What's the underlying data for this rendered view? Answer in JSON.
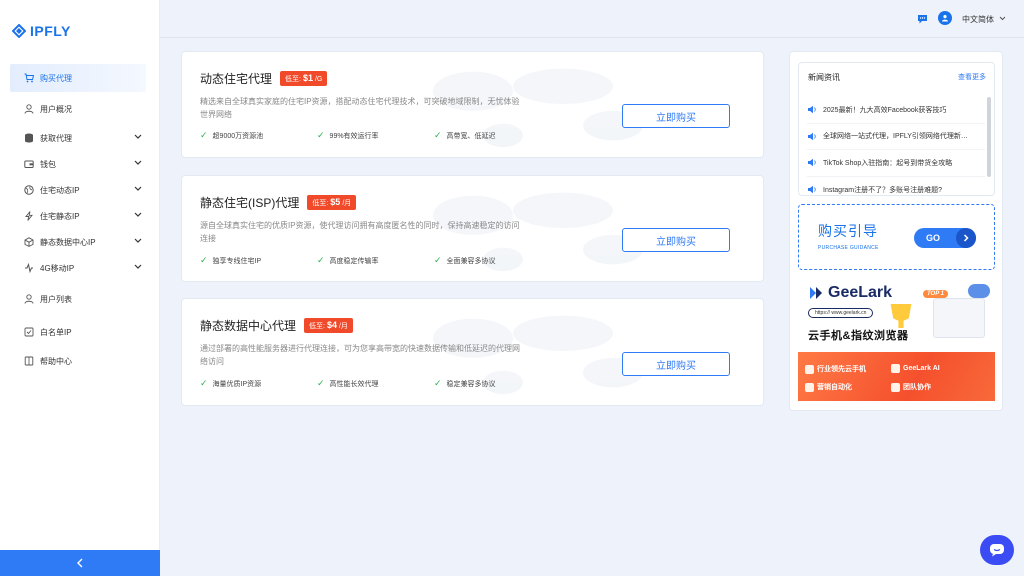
{
  "brand": {
    "name": "IPFLY"
  },
  "sidebar": {
    "items": [
      {
        "label": "购买代理",
        "icon": "cart-icon",
        "expandable": false,
        "active": true
      },
      {
        "label": "用户概况",
        "icon": "user-icon",
        "expandable": false
      },
      {
        "label": "获取代理",
        "icon": "database-icon",
        "expandable": true
      },
      {
        "label": "钱包",
        "icon": "wallet-icon",
        "expandable": true
      },
      {
        "label": "住宅动态IP",
        "icon": "globe-icon",
        "expandable": true
      },
      {
        "label": "住宅静态IP",
        "icon": "bolt-icon",
        "expandable": true
      },
      {
        "label": "静态数据中心IP",
        "icon": "cube-icon",
        "expandable": true
      },
      {
        "label": "4G移动IP",
        "icon": "signal-icon",
        "expandable": true
      },
      {
        "label": "用户列表",
        "icon": "user-list-icon",
        "expandable": false
      },
      {
        "label": "白名单IP",
        "icon": "checklist-icon",
        "expandable": false
      },
      {
        "label": "帮助中心",
        "icon": "book-icon",
        "expandable": false
      }
    ],
    "collapse_icon": "chevron-left-icon"
  },
  "header": {
    "language": "中文简体",
    "icons": [
      "message-icon",
      "user-avatar-icon",
      "chevron-down-icon"
    ]
  },
  "products": [
    {
      "title": "动态住宅代理",
      "price_prefix": "低至:",
      "price": "$1",
      "price_unit": "/G",
      "description": "精选来自全球真实家庭的住宅IP资源，搭配动态住宅代理技术，可突破地域限制，无忧体验世界网络",
      "features": [
        "超9000万资源池",
        "99%有效运行率",
        "高带宽、低延迟"
      ],
      "button": "立即购买"
    },
    {
      "title": "静态住宅(ISP)代理",
      "price_prefix": "低至:",
      "price": "$5",
      "price_unit": "/月",
      "description": "源自全球真实住宅的优质IP资源，使代理访问拥有高度匿名性的同时，保持高速稳定的访问连接",
      "features": [
        "独享专线住宅IP",
        "高度稳定传输率",
        "全面兼容多协议"
      ],
      "button": "立即购买"
    },
    {
      "title": "静态数据中心代理",
      "price_prefix": "低至:",
      "price": "$4",
      "price_unit": "/月",
      "description": "通过部署的高性能服务器进行代理连接，可为您享高带宽的快速数据传输和低延迟的代理网络访问",
      "features": [
        "海量优质IP资源",
        "高性能长效代理",
        "稳定兼容多协议"
      ],
      "button": "立即购买"
    }
  ],
  "news": {
    "title": "新闻资讯",
    "more": "查看更多",
    "items": [
      "2025最新！九大高效Facebook获客技巧",
      "全球网络一站式代理，IPFLY引领网络代理新…",
      "TikTok Shop入驻指南：起号到带货全攻略",
      "Instagram注册不了？多账号注册难题?"
    ]
  },
  "guide": {
    "title": "购买引导",
    "subtitle": "PURCHASE GUIDANCE",
    "go": "GO"
  },
  "ad": {
    "brand": "GeeLark",
    "url": "https:// www.geelark.cn",
    "badge": "TOP 1",
    "headline": "云手机&指纹浏览器",
    "features": [
      "行业领先云手机",
      "GeeLark AI",
      "营销自动化",
      "团队协作"
    ]
  },
  "colors": {
    "accent": "#2f7af5",
    "price_badge": "#f04a2a",
    "check": "#2bb34a",
    "chat_fab": "#3b4cf5"
  }
}
